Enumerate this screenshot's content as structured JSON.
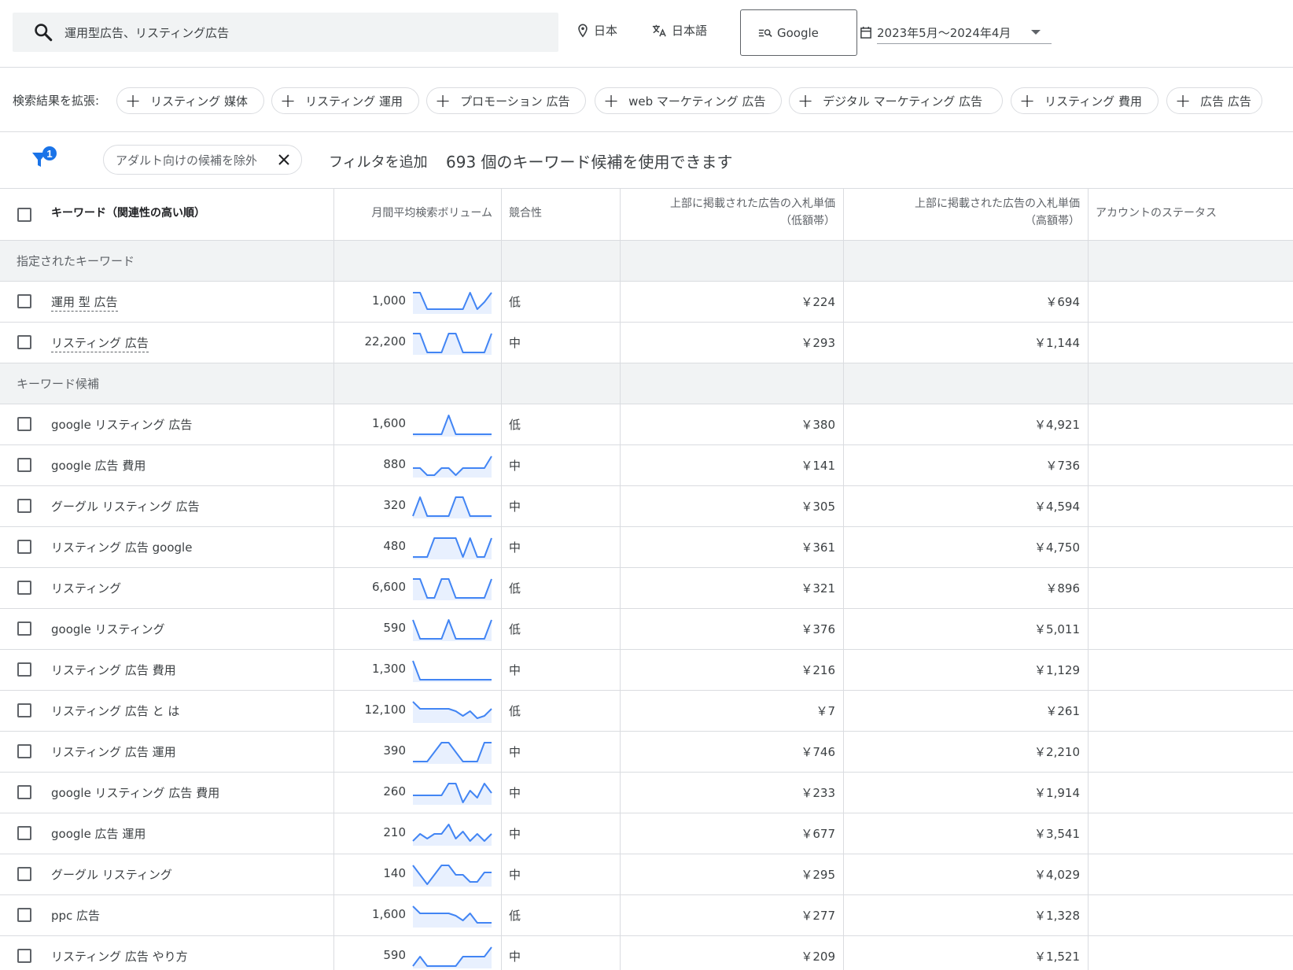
{
  "search": {
    "query": "運用型広告、リスティング広告"
  },
  "location": "日本",
  "language": "日本語",
  "engine": "Google",
  "date_range": "2023年5月～2024年4月",
  "expand": {
    "label": "検索結果を拡張:",
    "chips": [
      "リスティング 媒体",
      "リスティング 運用",
      "プロモーション 広告",
      "web マーケティング 広告",
      "デジタル マーケティング 広告",
      "リスティング 費用",
      "広告 広告"
    ]
  },
  "filter": {
    "badge": "1",
    "chip": "アダルト向けの候補を除外",
    "add": "フィルタを追加",
    "count": "693 個のキーワード候補を使用できます"
  },
  "columns": {
    "keyword": "キーワード（関連性の高い順）",
    "volume": "月間平均検索ボリューム",
    "competition": "競合性",
    "bid_low_1": "上部に掲載された広告の入札単価",
    "bid_low_2": "（低額帯）",
    "bid_high_1": "上部に掲載された広告の入札単価",
    "bid_high_2": "（高額帯）",
    "status": "アカウントのステータス"
  },
  "groups": {
    "specified": "指定されたキーワード",
    "ideas": "キーワード候補"
  },
  "specified_rows": [
    {
      "keyword": "運用 型 広告",
      "volume": "1,000",
      "competition": "低",
      "low": "￥224",
      "high": "￥694",
      "trend": [
        0.9,
        0.9,
        0.2,
        0.2,
        0.2,
        0.2,
        0.2,
        0.2,
        0.9,
        0.2,
        0.5,
        0.9
      ]
    },
    {
      "keyword": "リスティング 広告",
      "volume": "22,200",
      "competition": "中",
      "low": "￥293",
      "high": "￥1,144",
      "trend": [
        0.9,
        0.9,
        0.1,
        0.1,
        0.1,
        0.9,
        0.9,
        0.1,
        0.1,
        0.1,
        0.1,
        0.9
      ]
    }
  ],
  "idea_rows": [
    {
      "keyword": "google リスティング 広告",
      "volume": "1,600",
      "competition": "低",
      "low": "￥380",
      "high": "￥4,921",
      "trend": [
        0.1,
        0.1,
        0.1,
        0.1,
        0.1,
        0.9,
        0.1,
        0.1,
        0.1,
        0.1,
        0.1,
        0.1
      ]
    },
    {
      "keyword": "google 広告 費用",
      "volume": "880",
      "competition": "中",
      "low": "￥141",
      "high": "￥736",
      "trend": [
        0.4,
        0.4,
        0.1,
        0.1,
        0.4,
        0.4,
        0.1,
        0.4,
        0.4,
        0.4,
        0.4,
        0.9
      ]
    },
    {
      "keyword": "グーグル リスティング 広告",
      "volume": "320",
      "competition": "中",
      "low": "￥305",
      "high": "￥4,594",
      "trend": [
        0.1,
        0.9,
        0.1,
        0.1,
        0.1,
        0.1,
        0.9,
        0.9,
        0.1,
        0.1,
        0.1,
        0.1
      ]
    },
    {
      "keyword": "リスティング 広告 google",
      "volume": "480",
      "competition": "中",
      "low": "￥361",
      "high": "￥4,750",
      "trend": [
        0.1,
        0.1,
        0.1,
        0.9,
        0.9,
        0.9,
        0.9,
        0.1,
        0.9,
        0.1,
        0.1,
        0.9
      ]
    },
    {
      "keyword": "リスティング",
      "volume": "6,600",
      "competition": "低",
      "low": "￥321",
      "high": "￥896",
      "trend": [
        0.9,
        0.9,
        0.1,
        0.1,
        0.9,
        0.9,
        0.1,
        0.1,
        0.1,
        0.1,
        0.1,
        0.9
      ]
    },
    {
      "keyword": "google リスティング",
      "volume": "590",
      "competition": "低",
      "low": "￥376",
      "high": "￥5,011",
      "trend": [
        0.9,
        0.1,
        0.1,
        0.1,
        0.1,
        0.9,
        0.1,
        0.1,
        0.1,
        0.1,
        0.1,
        0.9
      ]
    },
    {
      "keyword": "リスティング 広告 費用",
      "volume": "1,300",
      "competition": "中",
      "low": "￥216",
      "high": "￥1,129",
      "trend": [
        0.9,
        0.1,
        0.1,
        0.1,
        0.1,
        0.1,
        0.1,
        0.1,
        0.1,
        0.1,
        0.1,
        0.1
      ]
    },
    {
      "keyword": "リスティング 広告 と は",
      "volume": "12,100",
      "competition": "低",
      "low": "￥7",
      "high": "￥261",
      "trend": [
        0.9,
        0.6,
        0.6,
        0.6,
        0.6,
        0.6,
        0.5,
        0.3,
        0.5,
        0.2,
        0.3,
        0.6
      ]
    },
    {
      "keyword": "リスティング 広告 運用",
      "volume": "390",
      "competition": "中",
      "low": "￥746",
      "high": "￥2,210",
      "trend": [
        0.1,
        0.1,
        0.1,
        0.5,
        0.9,
        0.9,
        0.5,
        0.1,
        0.1,
        0.1,
        0.9,
        0.9
      ]
    },
    {
      "keyword": "google リスティング 広告 費用",
      "volume": "260",
      "competition": "中",
      "low": "￥233",
      "high": "￥1,914",
      "trend": [
        0.4,
        0.4,
        0.4,
        0.4,
        0.4,
        0.9,
        0.9,
        0.1,
        0.6,
        0.3,
        0.9,
        0.5
      ]
    },
    {
      "keyword": "google 広告 運用",
      "volume": "210",
      "competition": "中",
      "low": "￥677",
      "high": "￥3,541",
      "trend": [
        0.2,
        0.5,
        0.3,
        0.5,
        0.5,
        0.9,
        0.3,
        0.6,
        0.2,
        0.5,
        0.2,
        0.5
      ]
    },
    {
      "keyword": "グーグル リスティング",
      "volume": "140",
      "competition": "中",
      "low": "￥295",
      "high": "￥4,029",
      "trend": [
        0.9,
        0.5,
        0.1,
        0.5,
        0.9,
        0.9,
        0.5,
        0.5,
        0.2,
        0.2,
        0.6,
        0.6
      ]
    },
    {
      "keyword": "ppc 広告",
      "volume": "1,600",
      "competition": "低",
      "low": "￥277",
      "high": "￥1,328",
      "trend": [
        0.9,
        0.6,
        0.6,
        0.6,
        0.6,
        0.6,
        0.5,
        0.3,
        0.6,
        0.2,
        0.2,
        0.2
      ]
    },
    {
      "keyword": "リスティング 広告 やり方",
      "volume": "590",
      "competition": "中",
      "low": "￥209",
      "high": "￥1,521",
      "trend": [
        0.1,
        0.5,
        0.1,
        0.1,
        0.1,
        0.1,
        0.1,
        0.5,
        0.5,
        0.5,
        0.5,
        0.9
      ]
    }
  ],
  "colors": {
    "spark_line": "#4285f4",
    "spark_fill": "#e8f0fe",
    "badge": "#1a73e8"
  }
}
